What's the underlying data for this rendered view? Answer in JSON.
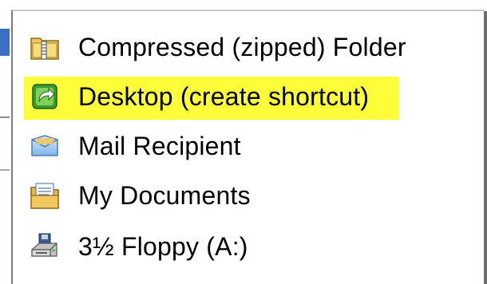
{
  "send_to_menu": {
    "items": [
      {
        "label": "Compressed (zipped) Folder",
        "icon": "zip-folder-icon"
      },
      {
        "label": "Desktop (create shortcut)",
        "icon": "desktop-shortcut-icon",
        "highlighted": true,
        "highlight_color": "#fdfd3a"
      },
      {
        "label": "Mail Recipient",
        "icon": "mail-recipient-icon"
      },
      {
        "label": "My Documents",
        "icon": "my-documents-icon"
      },
      {
        "label": "3½ Floppy (A:)",
        "icon": "floppy-drive-icon"
      }
    ]
  }
}
